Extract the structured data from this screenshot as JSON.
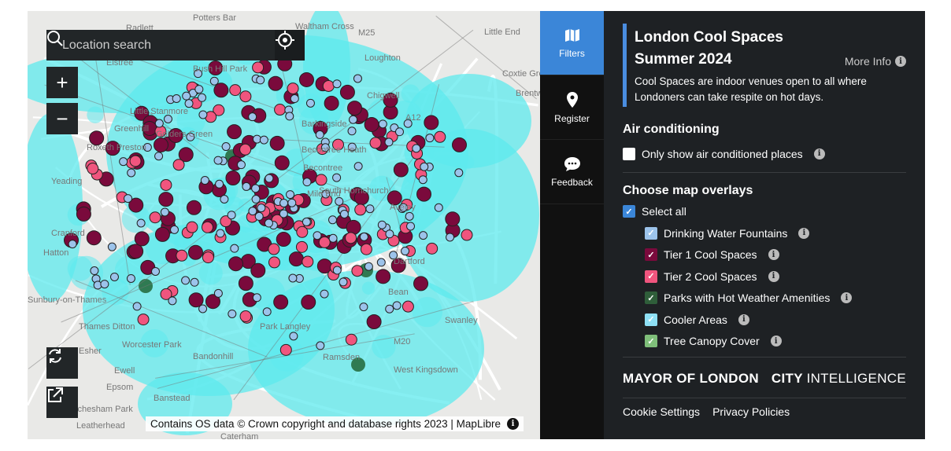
{
  "map": {
    "search_placeholder": "Location search",
    "zoom_in": "+",
    "zoom_out": "−",
    "attribution": "Contains OS data © Crown copyright and database rights 2023 | MapLibre",
    "labels": [
      "Potters Bar",
      "Radlett",
      "Waltham Cross",
      "Little End",
      "Loughton",
      "Coxtie Green",
      "Chigwell",
      "Brentwood",
      "Little Stanmore",
      "Greenhill",
      "Golders Green",
      "Roxeth Preston",
      "Barkingside",
      "Becontree Heath",
      "Becontree",
      "South Hornchurch",
      "Yeading",
      "Mile End",
      "Cranford",
      "Hatton",
      "Sunbury-on-Thames",
      "Thames Ditton",
      "Worcester Park",
      "Esher",
      "Ewell",
      "Epsom",
      "Banstead",
      "Pachesham Park",
      "Leatherhead",
      "Bandonhill",
      "Park Langley",
      "Swanley",
      "Dartford",
      "Bean",
      "West Kingsdown",
      "Ramsden",
      "Caterham",
      "Elstree",
      "Bush Hill Park",
      "Aveley",
      "M25",
      "A12",
      "M20"
    ],
    "colors": {
      "tier1": "#7a0a3c",
      "tier2": "#f0557e",
      "fountain": "#9cc3ea",
      "cooler": "#5ee9ee",
      "park": "#2f7a52"
    }
  },
  "nav": [
    {
      "label": "Filters",
      "icon": "map-icon",
      "active": true
    },
    {
      "label": "Register",
      "icon": "map-pin-icon"
    },
    {
      "label": "Feedback",
      "icon": "chat-bubble-icon"
    }
  ],
  "panel": {
    "title_line1": "London Cool Spaces",
    "title_line2": "Summer 2024",
    "more_info": "More Info",
    "description": "Cool Spaces are indoor venues open to all where Londoners can take respite on hot days.",
    "ac_heading": "Air conditioning",
    "ac_label": "Only show air conditioned places",
    "ac_checked": false,
    "overlays_heading": "Choose map overlays",
    "select_all": "Select all",
    "overlays": [
      {
        "label": "Drinking Water Fountains",
        "color": "#9cc3ea",
        "checked": true
      },
      {
        "label": "Tier 1 Cool Spaces",
        "color": "#7a0a3c",
        "checked": true
      },
      {
        "label": "Tier 2 Cool Spaces",
        "color": "#f0557e",
        "checked": true
      },
      {
        "label": "Parks with Hot Weather Amenities",
        "color": "#2f5e3a",
        "checked": true
      },
      {
        "label": "Cooler Areas",
        "color": "#8ee0f5",
        "checked": true
      },
      {
        "label": "Tree Canopy Cover",
        "color": "#7fbf7a",
        "checked": true
      }
    ],
    "logo_mayor": "MAYOR OF LONDON",
    "logo_city_bold": "CITY",
    "logo_city_light": "INTELLIGENCE",
    "cookie": "Cookie Settings",
    "privacy": "Privacy Policies"
  }
}
